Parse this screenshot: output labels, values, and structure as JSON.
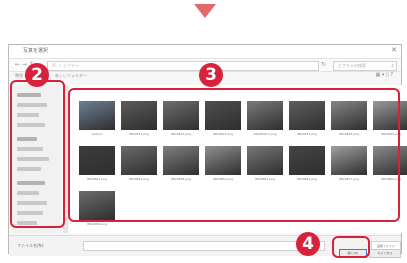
{
  "dialog": {
    "title": "写真を選択",
    "close_glyph": "✕",
    "nav_glyphs": "← → ↑",
    "path": "PC > ピクチャ",
    "refresh_glyph": "↻",
    "search_placeholder": "ピクチャの検索",
    "search_glyph": "⌕",
    "organize_label": "整理 ▾",
    "new_folder_label": "新しいフォルダー",
    "view_glyphs": "▦ ▾ ▯ ?"
  },
  "files": [
    {
      "name": "picture",
      "tone": "#6f7f95"
    },
    {
      "name": "IMG0812.png",
      "tone": "#5a5a5a"
    },
    {
      "name": "IMG0813.png",
      "tone": "#6d6d6d"
    },
    {
      "name": "IMG0814.png",
      "tone": "#4e4e4e"
    },
    {
      "name": "IMG0820-1.png",
      "tone": "#7a7a7a"
    },
    {
      "name": "IMG0834.png",
      "tone": "#5e5e5e"
    },
    {
      "name": "IMG0835.png",
      "tone": "#858585"
    },
    {
      "name": "IMG0836.png",
      "tone": "#9a9a9a"
    },
    {
      "name": "IMG0841.png",
      "tone": "#3d3d3d"
    },
    {
      "name": "IMG0842.png",
      "tone": "#6a6a6a"
    },
    {
      "name": "IMG0848.png",
      "tone": "#808080"
    },
    {
      "name": "IMG0850.png",
      "tone": "#909090"
    },
    {
      "name": "IMG0851.png",
      "tone": "#777777"
    },
    {
      "name": "IMG0861.png",
      "tone": "#454545"
    },
    {
      "name": "IMG0877.png",
      "tone": "#a0a0a0"
    },
    {
      "name": "IMG0896.png",
      "tone": "#8b8b8b"
    },
    {
      "name": "IMG0900.png",
      "tone": "#6c6c6c"
    }
  ],
  "footer": {
    "filename_label": "ファイル名(N):",
    "filetype_label": "画像ファイル",
    "open_label": "開く(O)",
    "cancel_label": "キャンセル"
  },
  "badges": {
    "sidebar": "2",
    "content": "3",
    "open": "4"
  },
  "colors": {
    "highlight": "#d8213a",
    "arrow": "#e06a6a"
  }
}
